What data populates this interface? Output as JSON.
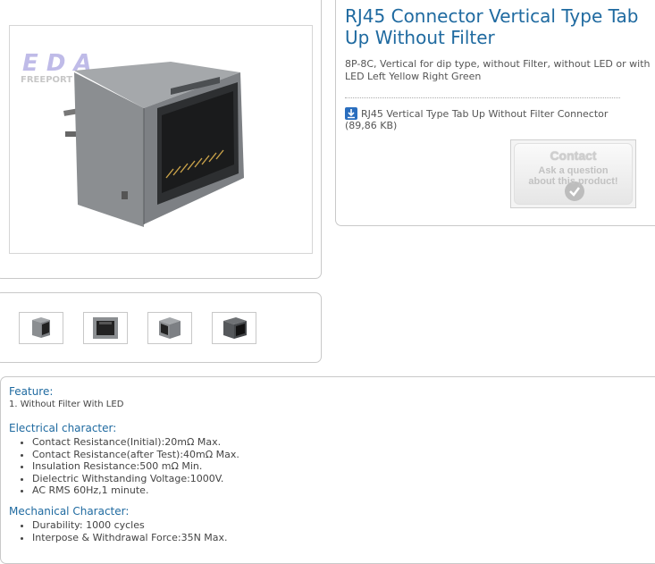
{
  "product": {
    "title": "RJ45 Connector Vertical Type Tab Up Without Filter",
    "subtitle": "8P-8C, Vertical for dip type, without Filter, without LED or with LED Left Yellow Right Green",
    "download_label": "RJ45 Vertical Type Tab Up Without Filter Connector",
    "download_size": "(89,86 KB)",
    "watermark_logo_text": "FREEPORT"
  },
  "contact": {
    "title": "Contact",
    "line1": "Ask a question",
    "line2": "about this product!"
  },
  "thumbnails": [
    {
      "name": "thumb-1"
    },
    {
      "name": "thumb-2"
    },
    {
      "name": "thumb-3"
    },
    {
      "name": "thumb-4"
    }
  ],
  "description": {
    "feature": {
      "heading": "Feature:",
      "text": "1. Without Filter With LED"
    },
    "electrical": {
      "heading": "Electrical character:",
      "items": [
        "Contact Resistance(Initial):20mΩ Max.",
        "Contact Resistance(after Test):40mΩ Max.",
        "Insulation Resistance:500 mΩ Min.",
        "Dielectric Withstanding Voltage:1000V.",
        "AC RMS 60Hz,1 minute."
      ]
    },
    "mechanical": {
      "heading": "Mechanical Character:",
      "items": [
        "Durability: 1000 cycles",
        "Interpose & Withdrawal Force:35N Max."
      ]
    }
  },
  "colors": {
    "title_blue": "#1f6aa0",
    "border_gray": "#c9c9c9",
    "download_icon_blue": "#2a6ebe"
  }
}
